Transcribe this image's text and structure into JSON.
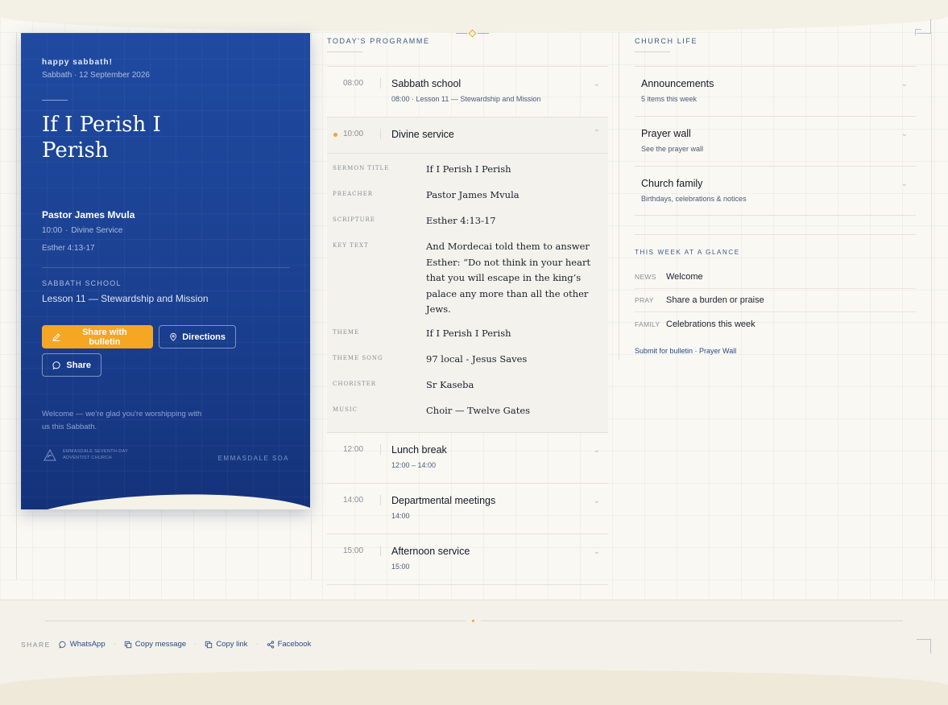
{
  "hero": {
    "greeting": "happy sabbath!",
    "date": "Sabbath · 12 September 2026",
    "title": "If I Perish I Perish",
    "preacher": "Pastor James Mvula",
    "time": "10:00",
    "service": "Divine Service",
    "scripture": "Esther 4:13-17",
    "sabbath_school_label": "SABBATH SCHOOL",
    "sabbath_school_lesson": "Lesson 11 — Stewardship and Mission",
    "share_bulletin_label": "Share with bulletin",
    "directions_label": "Directions",
    "share_label": "Share",
    "welcome": "Welcome — we're glad you're worshipping with us this Sabbath.",
    "logo_text": "EMMASDALE SEVENTH-DAY ADVENTIST CHURCH",
    "brand": "EMMASDALE SDA"
  },
  "programme": {
    "label": "TODAY'S PROGRAMME",
    "items": [
      {
        "time": "08:00",
        "title": "Sabbath school",
        "sub": "08:00 · Lesson 11 — Stewardship and Mission"
      },
      {
        "time": "10:00",
        "title": "Divine service",
        "sub": ""
      },
      {
        "time": "12:00",
        "title": "Lunch break",
        "sub": "12:00 – 14:00"
      },
      {
        "time": "14:00",
        "title": "Departmental meetings",
        "sub": "14:00"
      },
      {
        "time": "15:00",
        "title": "Afternoon service",
        "sub": "15:00"
      }
    ],
    "details": [
      {
        "label": "SERMON TITLE",
        "value": "If I Perish I Perish"
      },
      {
        "label": "PREACHER",
        "value": "Pastor James Mvula"
      },
      {
        "label": "SCRIPTURE",
        "value": "Esther 4:13-17"
      },
      {
        "label": "KEY TEXT",
        "value": "And Mordecai told them to answer Esther: “Do not think in your heart that you will escape in the king’s palace any more than all the other Jews."
      },
      {
        "label": "THEME",
        "value": "If I Perish I Perish"
      },
      {
        "label": "THEME SONG",
        "value": "97 local - Jesus Saves"
      },
      {
        "label": "CHORISTER",
        "value": "Sr Kaseba"
      },
      {
        "label": "MUSIC",
        "value": "Choir — Twelve Gates"
      }
    ]
  },
  "church_life": {
    "label": "CHURCH LIFE",
    "items": [
      {
        "title": "Announcements",
        "sub": "5 items this week"
      },
      {
        "title": "Prayer wall",
        "sub": "See the prayer wall"
      },
      {
        "title": "Church family",
        "sub": "Birthdays, celebrations & notices"
      }
    ],
    "glance_label": "THIS WEEK AT A GLANCE",
    "glance": [
      {
        "tag": "NEWS",
        "text": "Welcome"
      },
      {
        "tag": "PRAY",
        "text": "Share a burden or praise"
      },
      {
        "tag": "FAMILY",
        "text": "Celebrations this week"
      }
    ],
    "links": "Submit for bulletin · Prayer Wall"
  },
  "footer": {
    "share_label": "SHARE",
    "whatsapp": "WhatsApp",
    "copy_message": "Copy message",
    "copy_link": "Copy link",
    "facebook": "Facebook"
  },
  "colors": {
    "hero_blue": "#1f4aa0",
    "accent_orange": "#f5a623",
    "link_blue": "#2a4a8a"
  }
}
